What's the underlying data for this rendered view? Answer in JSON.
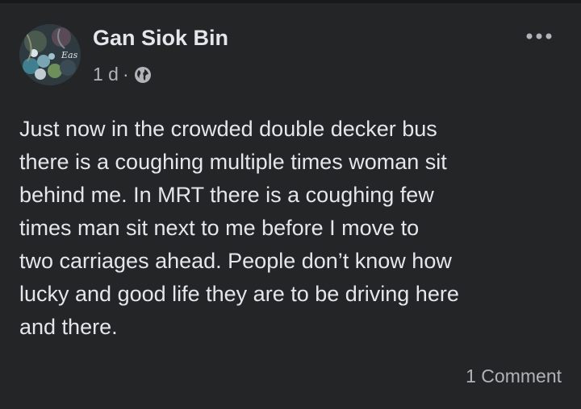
{
  "post": {
    "author": "Gan Siok Bin",
    "time": "1 d",
    "separator": "·",
    "privacy_icon": "globe-icon",
    "more_icon": "more-options-icon",
    "avatar_text": "Eas",
    "text_lines": [
      "Just now in the crowded double decker bus",
      "there is a coughing multiple times woman sit",
      "behind me. In MRT there is a coughing few",
      "times man sit next to me before I move to",
      "two carriages ahead. People don’t know how",
      "lucky and good life they are to be driving here",
      "and there."
    ],
    "comments_label": "1 Comment"
  },
  "colors": {
    "background": "#242526",
    "primary_text": "#e4e6eb",
    "secondary_text": "#b0b3b8"
  }
}
